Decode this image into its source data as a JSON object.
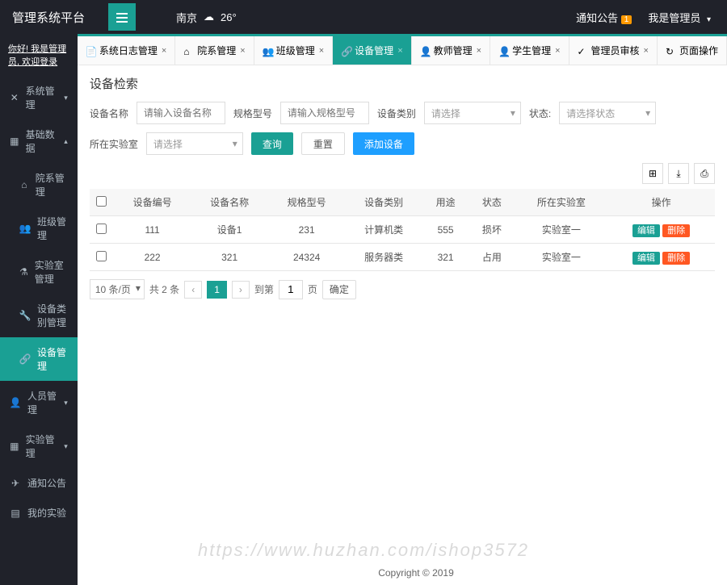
{
  "header": {
    "logo": "管理系统平台",
    "weather_city": "南京",
    "weather_temp": "26°",
    "notice": "通知公告",
    "notice_badge": "1",
    "user_menu": "我是管理员"
  },
  "sidebar": {
    "welcome_prefix": "你好! ",
    "welcome_user": "我是管理员",
    "welcome_suffix": ", 欢迎登录",
    "items": [
      {
        "label": "系统管理",
        "icon": "gear",
        "has_arrow": true
      },
      {
        "label": "基础数据",
        "icon": "date",
        "has_arrow": true,
        "expanded": true,
        "children": [
          {
            "label": "院系管理",
            "icon": "home"
          },
          {
            "label": "班级管理",
            "icon": "users"
          },
          {
            "label": "实验室管理",
            "icon": "lab"
          },
          {
            "label": "设备类别管理",
            "icon": "wrench"
          },
          {
            "label": "设备管理",
            "icon": "link",
            "active": true
          }
        ]
      },
      {
        "label": "人员管理",
        "icon": "user",
        "has_arrow": true
      },
      {
        "label": "实验管理",
        "icon": "calendar",
        "has_arrow": true
      },
      {
        "label": "通知公告",
        "icon": "send"
      },
      {
        "label": "我的实验",
        "icon": "list"
      }
    ]
  },
  "tabs": [
    {
      "label": "系统日志管理",
      "icon": "file"
    },
    {
      "label": "院系管理",
      "icon": "home"
    },
    {
      "label": "班级管理",
      "icon": "users"
    },
    {
      "label": "设备管理",
      "icon": "link",
      "active": true
    },
    {
      "label": "教师管理",
      "icon": "user"
    },
    {
      "label": "学生管理",
      "icon": "user"
    },
    {
      "label": "管理员审核",
      "icon": "check"
    }
  ],
  "page_ops": "页面操作",
  "panel": {
    "title": "设备检索",
    "fields": {
      "name_label": "设备名称",
      "name_placeholder": "请输入设备名称",
      "spec_label": "规格型号",
      "spec_placeholder": "请输入规格型号",
      "category_label": "设备类别",
      "category_placeholder": "请选择",
      "status_label": "状态:",
      "status_placeholder": "请选择状态",
      "lab_label": "所在实验室",
      "lab_placeholder": "请选择"
    },
    "buttons": {
      "search": "查询",
      "reset": "重置",
      "add": "添加设备"
    }
  },
  "table": {
    "headers": [
      "",
      "设备编号",
      "设备名称",
      "规格型号",
      "设备类别",
      "用途",
      "状态",
      "所在实验室",
      "操作"
    ],
    "rows": [
      {
        "id": "111",
        "name": "设备1",
        "spec": "231",
        "category": "计算机类",
        "use": "555",
        "status": "损坏",
        "lab": "实验室一"
      },
      {
        "id": "222",
        "name": "321",
        "spec": "24324",
        "category": "服务器类",
        "use": "321",
        "status": "占用",
        "lab": "实验室一"
      }
    ],
    "actions": {
      "edit": "编辑",
      "delete": "删除"
    }
  },
  "pagination": {
    "page_size": "10 条/页",
    "total": "共 2 条",
    "current": "1",
    "goto_label": "到第",
    "goto_value": "1",
    "page_label": "页",
    "confirm": "确定"
  },
  "footer": "Copyright © 2019",
  "watermark": "https://www.huzhan.com/ishop3572"
}
